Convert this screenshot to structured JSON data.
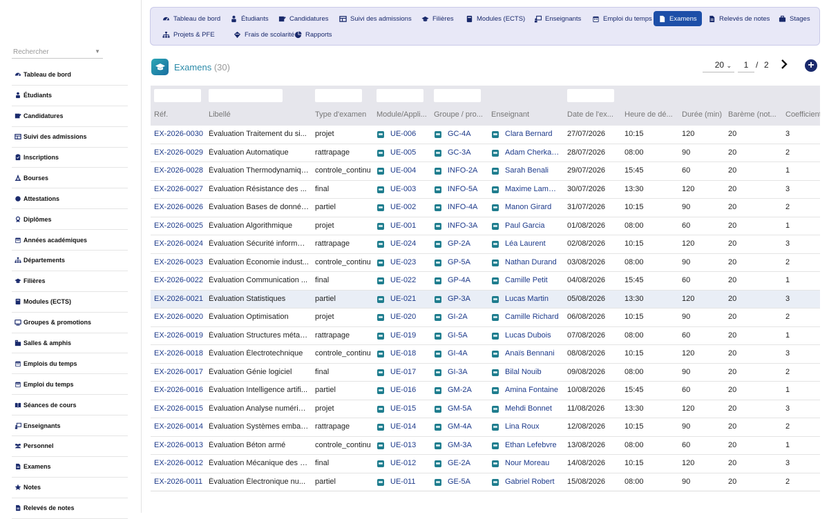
{
  "sidebar": {
    "search_placeholder": "Rechercher",
    "items": [
      {
        "label": "Tableau de bord",
        "icon": "dashboard-icon"
      },
      {
        "label": "Étudiants",
        "icon": "student-icon"
      },
      {
        "label": "Candidatures",
        "icon": "application-icon"
      },
      {
        "label": "Suivi des admissions",
        "icon": "table-icon"
      },
      {
        "label": "Inscriptions",
        "icon": "clipboard-icon"
      },
      {
        "label": "Bourses",
        "icon": "scholarship-icon"
      },
      {
        "label": "Attestations",
        "icon": "certificate-icon"
      },
      {
        "label": "Diplômes",
        "icon": "diploma-icon"
      },
      {
        "label": "Années académiques",
        "icon": "calendar-icon"
      },
      {
        "label": "Départements",
        "icon": "sitemap-icon"
      },
      {
        "label": "Filières",
        "icon": "graduation-cap-icon"
      },
      {
        "label": "Modules (ECTS)",
        "icon": "book-icon"
      },
      {
        "label": "Groupes & promotions",
        "icon": "monitor-icon"
      },
      {
        "label": "Salles & amphis",
        "icon": "building-icon"
      },
      {
        "label": "Emplois du temps",
        "icon": "calendar-icon"
      },
      {
        "label": "Emploi du temps",
        "icon": "calendar-icon"
      },
      {
        "label": "Séances de cours",
        "icon": "open-book-icon"
      },
      {
        "label": "Enseignants",
        "icon": "teacher-icon"
      },
      {
        "label": "Personnel",
        "icon": "users-icon"
      },
      {
        "label": "Examens",
        "icon": "document-icon"
      },
      {
        "label": "Notes",
        "icon": "star-icon"
      },
      {
        "label": "Relevés de notes",
        "icon": "document-icon"
      }
    ]
  },
  "nav": {
    "tabs": [
      {
        "label": "Tableau de bord",
        "icon": "dashboard-icon",
        "active": false
      },
      {
        "label": "Étudiants",
        "icon": "student-icon",
        "active": false
      },
      {
        "label": "Candidatures",
        "icon": "application-icon",
        "active": false
      },
      {
        "label": "Suivi des admissions",
        "icon": "table-icon",
        "active": false
      },
      {
        "label": "Filières",
        "icon": "graduation-cap-icon",
        "active": false
      },
      {
        "label": "Modules (ECTS)",
        "icon": "book-icon",
        "active": false
      },
      {
        "label": "Enseignants",
        "icon": "teacher-icon",
        "active": false
      },
      {
        "label": "Emploi du temps",
        "icon": "calendar-icon",
        "active": false
      },
      {
        "label": "Examens",
        "icon": "document-icon",
        "active": true
      },
      {
        "label": "Relevés de notes",
        "icon": "document-icon",
        "active": false
      },
      {
        "label": "Stages",
        "icon": "briefcase-icon",
        "active": false
      },
      {
        "label": "Projets & PFE",
        "icon": "sitemap-icon",
        "active": false
      },
      {
        "label": "Frais de scolarité",
        "icon": "fees-icon",
        "active": false
      },
      {
        "label": "Rapports",
        "icon": "pie-chart-icon",
        "active": false
      }
    ]
  },
  "page": {
    "title": "Examens",
    "count": "(30)",
    "per_page": "20",
    "current_page": "1",
    "page_sep": "/",
    "total_pages": "2"
  },
  "colors": {
    "accent": "#1d4fa8",
    "nav_bg": "#e8e8f7",
    "link": "#1d3a8a",
    "chip": "#1f7d8e",
    "title": "#2a8aa8"
  },
  "table": {
    "columns": [
      "Réf.",
      "Libellé",
      "Type d'examen",
      "Module/Appli...",
      "Groupe / pro...",
      "Enseignant",
      "Date de l'ex...",
      "Heure de dé...",
      "Durée (min)",
      "Barème (not...",
      "Coefficient"
    ],
    "rows": [
      [
        "EX-2026-0030",
        "Évaluation Traitement du si...",
        "projet",
        "UE-006",
        "GC-4A",
        "Clara Bernard",
        "27/07/2026",
        "10:15",
        "120",
        "20",
        "3"
      ],
      [
        "EX-2026-0029",
        "Évaluation Automatique",
        "rattrapage",
        "UE-005",
        "GC-3A",
        "Adam Cherkaoui",
        "28/07/2026",
        "08:00",
        "90",
        "20",
        "2"
      ],
      [
        "EX-2026-0028",
        "Évaluation Thermodynamique",
        "controle_continu",
        "UE-004",
        "INFO-2A",
        "Sarah Benali",
        "29/07/2026",
        "15:45",
        "60",
        "20",
        "1"
      ],
      [
        "EX-2026-0027",
        "Évaluation Résistance des ...",
        "final",
        "UE-003",
        "INFO-5A",
        "Maxime Lambert",
        "30/07/2026",
        "13:30",
        "120",
        "20",
        "3"
      ],
      [
        "EX-2026-0026",
        "Évaluation Bases de données",
        "partiel",
        "UE-002",
        "INFO-4A",
        "Manon Girard",
        "31/07/2026",
        "10:15",
        "90",
        "20",
        "2"
      ],
      [
        "EX-2026-0025",
        "Évaluation Algorithmique",
        "projet",
        "UE-001",
        "INFO-3A",
        "Paul Garcia",
        "01/08/2026",
        "08:00",
        "60",
        "20",
        "1"
      ],
      [
        "EX-2026-0024",
        "Évaluation Sécurité informat...",
        "rattrapage",
        "UE-024",
        "GP-2A",
        "Léa Laurent",
        "02/08/2026",
        "10:15",
        "120",
        "20",
        "3"
      ],
      [
        "EX-2026-0023",
        "Évaluation Économie indust...",
        "controle_continu",
        "UE-023",
        "GP-5A",
        "Nathan Durand",
        "03/08/2026",
        "08:00",
        "90",
        "20",
        "2"
      ],
      [
        "EX-2026-0022",
        "Évaluation Communication ...",
        "final",
        "UE-022",
        "GP-4A",
        "Camille Petit",
        "04/08/2026",
        "15:45",
        "60",
        "20",
        "1"
      ],
      [
        "EX-2026-0021",
        "Évaluation Statistiques",
        "partiel",
        "UE-021",
        "GP-3A",
        "Lucas Martin",
        "05/08/2026",
        "13:30",
        "120",
        "20",
        "3"
      ],
      [
        "EX-2026-0020",
        "Évaluation Optimisation",
        "projet",
        "UE-020",
        "GI-2A",
        "Camille Richard",
        "06/08/2026",
        "10:15",
        "90",
        "20",
        "2"
      ],
      [
        "EX-2026-0019",
        "Évaluation Structures métall...",
        "rattrapage",
        "UE-019",
        "GI-5A",
        "Lucas Dubois",
        "07/08/2026",
        "08:00",
        "60",
        "20",
        "1"
      ],
      [
        "EX-2026-0018",
        "Évaluation Électrotechnique",
        "controle_continu",
        "UE-018",
        "GI-4A",
        "Anaïs Bennani",
        "08/08/2026",
        "10:15",
        "120",
        "20",
        "3"
      ],
      [
        "EX-2026-0017",
        "Évaluation Génie logiciel",
        "final",
        "UE-017",
        "GI-3A",
        "Bilal Nouib",
        "09/08/2026",
        "08:00",
        "90",
        "20",
        "2"
      ],
      [
        "EX-2026-0016",
        "Évaluation Intelligence artifi...",
        "partiel",
        "UE-016",
        "GM-2A",
        "Amina Fontaine",
        "10/08/2026",
        "15:45",
        "60",
        "20",
        "1"
      ],
      [
        "EX-2026-0015",
        "Évaluation Analyse numérique",
        "projet",
        "UE-015",
        "GM-5A",
        "Mehdi Bonnet",
        "11/08/2026",
        "13:30",
        "120",
        "20",
        "3"
      ],
      [
        "EX-2026-0014",
        "Évaluation Systèmes embar...",
        "rattrapage",
        "UE-014",
        "GM-4A",
        "Lina Roux",
        "12/08/2026",
        "10:15",
        "90",
        "20",
        "2"
      ],
      [
        "EX-2026-0013",
        "Évaluation Béton armé",
        "controle_continu",
        "UE-013",
        "GM-3A",
        "Ethan Lefebvre",
        "13/08/2026",
        "08:00",
        "60",
        "20",
        "1"
      ],
      [
        "EX-2026-0012",
        "Évaluation Mécanique des fl...",
        "final",
        "UE-012",
        "GE-2A",
        "Nour Moreau",
        "14/08/2026",
        "10:15",
        "120",
        "20",
        "3"
      ],
      [
        "EX-2026-0011",
        "Évaluation Électronique nu...",
        "partiel",
        "UE-011",
        "GE-5A",
        "Gabriel Robert",
        "15/08/2026",
        "08:00",
        "90",
        "20",
        "2"
      ]
    ]
  }
}
